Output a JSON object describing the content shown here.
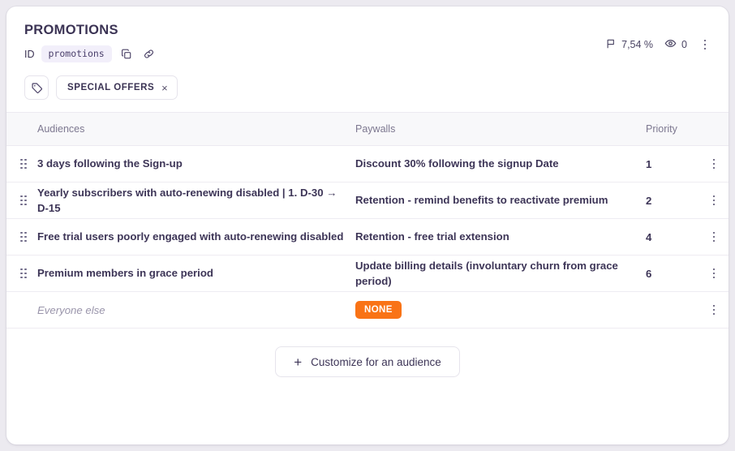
{
  "header": {
    "title": "PROMOTIONS",
    "id_label": "ID",
    "id_value": "promotions",
    "copy_icon": "copy-icon",
    "link_icon": "link-icon",
    "tag_icon": "tag-icon",
    "tags": [
      {
        "label": "SPECIAL OFFERS",
        "remove": "×"
      }
    ],
    "stats": {
      "flag_icon": "flag-icon",
      "flag_value": "7,54 %",
      "eye_icon": "eye-icon",
      "eye_value": "0"
    },
    "menu_icon": "kebab-menu-icon"
  },
  "table": {
    "columns": {
      "audiences": "Audiences",
      "paywalls": "Paywalls",
      "priority": "Priority"
    },
    "rows": [
      {
        "audience": "3 days following the Sign-up",
        "paywall": "Discount 30% following the signup Date",
        "priority": "1",
        "draggable": true,
        "badge": null
      },
      {
        "audience": "Yearly subscribers with auto-renewing disabled | 1. D-30 → D-15",
        "paywall": "Retention - remind benefits to reactivate premium",
        "priority": "2",
        "draggable": true,
        "badge": null
      },
      {
        "audience": "Free trial users poorly engaged with auto-renewing disabled",
        "paywall": "Retention - free trial extension",
        "priority": "4",
        "draggable": true,
        "badge": null
      },
      {
        "audience": "Premium members in grace period",
        "paywall": "Update billing details (involuntary churn from grace period)",
        "priority": "6",
        "draggable": true,
        "badge": null
      },
      {
        "audience": "Everyone else",
        "paywall": "",
        "priority": "",
        "draggable": false,
        "badge": "NONE"
      }
    ]
  },
  "footer": {
    "cta_plus": "+",
    "cta_label": "Customize for an audience"
  },
  "colors": {
    "accent_orange": "#f97316",
    "text_dark": "#3d3557",
    "text_muted": "#7d7890",
    "page_bg": "#eceaf0",
    "card_bg": "#ffffff",
    "header_row_bg": "#f8f8fa"
  }
}
